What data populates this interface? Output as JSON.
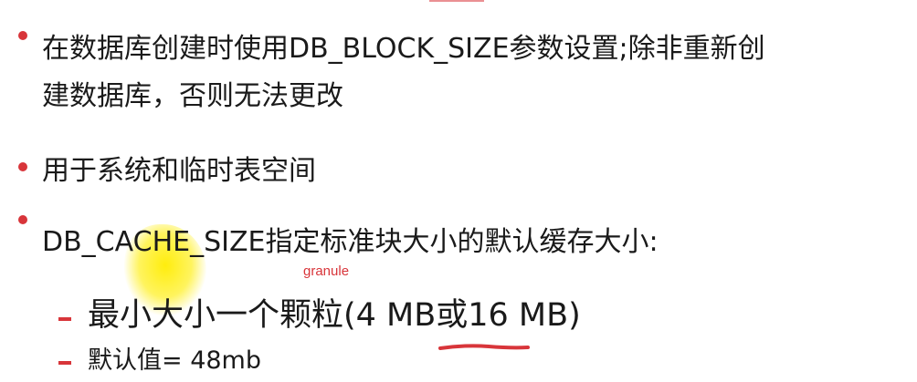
{
  "bullets": {
    "b1_line1": "在数据库创建时使用DB_BLOCK_SIZE参数设置;除非重新创",
    "b1_line2": "建数据库，否则无法更改",
    "b2": "用于系统和临时表空间",
    "b3": "DB_CACHE_SIZE指定标准块大小的默认缓存大小:"
  },
  "sub_items": {
    "s1": "最小大小一个颗粒(4 MB或16 MB)",
    "s2": "默认值= 48mb"
  },
  "annotation": {
    "text": "granule",
    "color": "#d8353a"
  },
  "colors": {
    "accent": "#d8353a",
    "highlighter": "#ffec00",
    "text": "#1a1a1a"
  }
}
